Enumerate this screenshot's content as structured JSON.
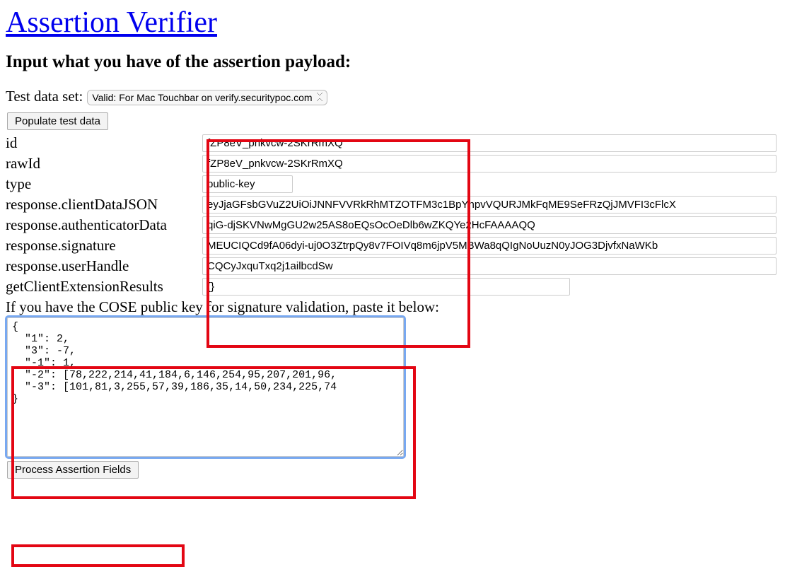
{
  "title": "Assertion Verifier",
  "subtitle": "Input what you have of the assertion payload:",
  "controls": {
    "test_data_label": "Test data set:",
    "test_data_selected": "Valid: For Mac Touchbar on verify.securitypoc.com",
    "populate_button": "Populate test data",
    "process_button": "Process Assertion Fields"
  },
  "fields": {
    "id": {
      "label": "id",
      "value": "fZP8eV_pnkvcw-2SKrRmXQ"
    },
    "rawId": {
      "label": "rawId",
      "value": "fZP8eV_pnkvcw-2SKrRmXQ"
    },
    "type": {
      "label": "type",
      "value": "public-key"
    },
    "clientDataJSON": {
      "label": "response.clientDataJSON",
      "value": "eyJjaGFsbGVuZ2UiOiJNNFVVRkRhMTZOTFM3c1BpYnpvVQURJMkFqME9SeFRzQjJMVFI3cFlcX"
    },
    "authenticatorData": {
      "label": "response.authenticatorData",
      "value": "qiG-djSKVNwMgGU2w25AS8oEQsOcOeDlb6wZKQYe2HcFAAAAQQ"
    },
    "signature": {
      "label": "response.signature",
      "value": "MEUCIQCd9fA06dyi-uj0O3ZtrpQy8v7FOIVq8m6jpV5MBWa8qQIgNoUuzN0yJOG3DjvfxNaWKb"
    },
    "userHandle": {
      "label": "response.userHandle",
      "value": "CQCyJxquTxq2j1ailbcdSw"
    },
    "extResults": {
      "label": "getClientExtensionResults",
      "value": "{}"
    }
  },
  "cose": {
    "hint": "If you have the COSE public key for signature validation, paste it below:",
    "value": "{\n  \"1\": 2,\n  \"3\": -7,\n  \"-1\": 1,\n  \"-2\": [78,222,214,41,184,6,146,254,95,207,201,96,\n  \"-3\": [101,81,3,255,57,39,186,35,14,50,234,225,74\n}"
  }
}
